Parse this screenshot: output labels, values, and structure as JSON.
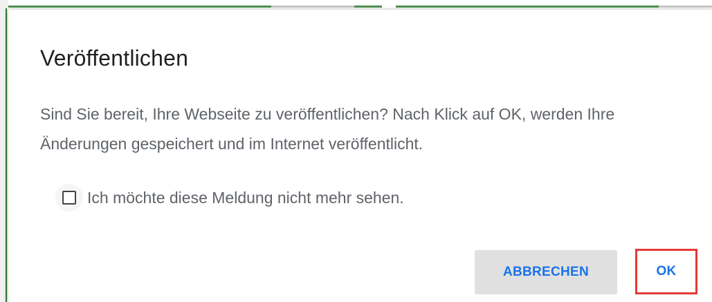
{
  "dialog": {
    "title": "Veröffentlichen",
    "message": "Sind Sie bereit, Ihre Webseite zu veröffentlichen? Nach Klick auf OK, werden Ihre Änderungen gespeichert und im Internet veröffentlicht.",
    "checkbox": {
      "label": "Ich möchte diese Meldung nicht mehr sehen.",
      "checked": false
    },
    "buttons": {
      "cancel_label": "ABBRECHEN",
      "ok_label": "OK"
    }
  },
  "colors": {
    "accent": "#1a73e8",
    "highlight_border": "#e53935",
    "cancel_bg": "#e0e0e0",
    "background_edge": "#2e7d32"
  }
}
